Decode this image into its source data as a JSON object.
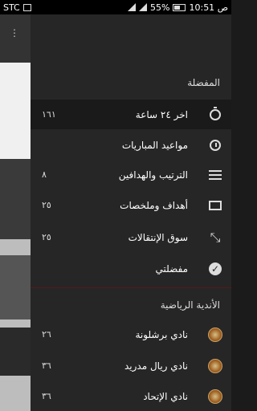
{
  "statusbar": {
    "carrier": "STC",
    "battery": "55%",
    "time": "10:51 ص"
  },
  "drawer": {
    "favorites_title": "المفضلة",
    "items": [
      {
        "label": "اخر ٢٤ ساعة",
        "count": "١٦١",
        "icon": "timer-icon",
        "active": true
      },
      {
        "label": "مواعيد المباريات",
        "count": "",
        "icon": "clock-icon",
        "active": false
      },
      {
        "label": "الترتيب والهدافين",
        "count": "٨",
        "icon": "list-icon",
        "active": false
      },
      {
        "label": "أهداف وملخصات",
        "count": "٢٥",
        "icon": "film-icon",
        "active": false
      },
      {
        "label": "سوق الإنتقالات",
        "count": "٢٥",
        "icon": "shrink-icon",
        "active": false
      },
      {
        "label": "مفضلتي",
        "count": "",
        "icon": "check-circle-icon",
        "active": false
      }
    ],
    "clubs_title": "الأندية الرياضية",
    "clubs": [
      {
        "label": "نادي برشلونة",
        "count": "٢٦",
        "icon": "club-icon"
      },
      {
        "label": "نادي ريال مدريد",
        "count": "٣٦",
        "icon": "club-icon"
      },
      {
        "label": "نادي الإتحاد",
        "count": "٣٦",
        "icon": "club-icon"
      }
    ]
  }
}
